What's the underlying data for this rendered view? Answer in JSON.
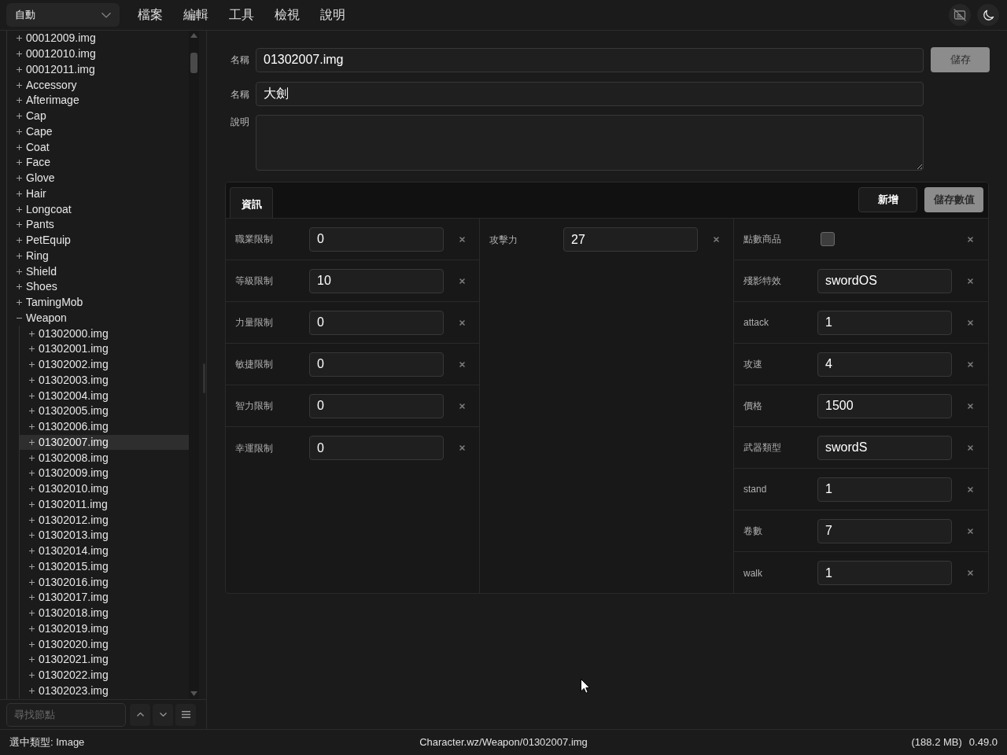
{
  "menu_bar": {
    "mode_select": {
      "value": "自動"
    },
    "menus": [
      "檔案",
      "編輯",
      "工具",
      "檢視",
      "說明"
    ]
  },
  "tree": {
    "items": [
      {
        "label": "00012009.img",
        "expanded": false,
        "selected": false
      },
      {
        "label": "00012010.img",
        "expanded": false,
        "selected": false
      },
      {
        "label": "00012011.img",
        "expanded": false,
        "selected": false
      },
      {
        "label": "Accessory",
        "expanded": false,
        "selected": false
      },
      {
        "label": "Afterimage",
        "expanded": false,
        "selected": false
      },
      {
        "label": "Cap",
        "expanded": false,
        "selected": false
      },
      {
        "label": "Cape",
        "expanded": false,
        "selected": false
      },
      {
        "label": "Coat",
        "expanded": false,
        "selected": false
      },
      {
        "label": "Face",
        "expanded": false,
        "selected": false
      },
      {
        "label": "Glove",
        "expanded": false,
        "selected": false
      },
      {
        "label": "Hair",
        "expanded": false,
        "selected": false
      },
      {
        "label": "Longcoat",
        "expanded": false,
        "selected": false
      },
      {
        "label": "Pants",
        "expanded": false,
        "selected": false
      },
      {
        "label": "PetEquip",
        "expanded": false,
        "selected": false
      },
      {
        "label": "Ring",
        "expanded": false,
        "selected": false
      },
      {
        "label": "Shield",
        "expanded": false,
        "selected": false
      },
      {
        "label": "Shoes",
        "expanded": false,
        "selected": false
      },
      {
        "label": "TamingMob",
        "expanded": false,
        "selected": false
      },
      {
        "label": "Weapon",
        "expanded": true,
        "selected": false,
        "children": [
          {
            "label": "01302000.img",
            "expanded": false,
            "selected": false
          },
          {
            "label": "01302001.img",
            "expanded": false,
            "selected": false
          },
          {
            "label": "01302002.img",
            "expanded": false,
            "selected": false
          },
          {
            "label": "01302003.img",
            "expanded": false,
            "selected": false
          },
          {
            "label": "01302004.img",
            "expanded": false,
            "selected": false
          },
          {
            "label": "01302005.img",
            "expanded": false,
            "selected": false
          },
          {
            "label": "01302006.img",
            "expanded": false,
            "selected": false
          },
          {
            "label": "01302007.img",
            "expanded": false,
            "selected": true
          },
          {
            "label": "01302008.img",
            "expanded": false,
            "selected": false
          },
          {
            "label": "01302009.img",
            "expanded": false,
            "selected": false
          },
          {
            "label": "01302010.img",
            "expanded": false,
            "selected": false
          },
          {
            "label": "01302011.img",
            "expanded": false,
            "selected": false
          },
          {
            "label": "01302012.img",
            "expanded": false,
            "selected": false
          },
          {
            "label": "01302013.img",
            "expanded": false,
            "selected": false
          },
          {
            "label": "01302014.img",
            "expanded": false,
            "selected": false
          },
          {
            "label": "01302015.img",
            "expanded": false,
            "selected": false
          },
          {
            "label": "01302016.img",
            "expanded": false,
            "selected": false
          },
          {
            "label": "01302017.img",
            "expanded": false,
            "selected": false
          },
          {
            "label": "01302018.img",
            "expanded": false,
            "selected": false
          },
          {
            "label": "01302019.img",
            "expanded": false,
            "selected": false
          },
          {
            "label": "01302020.img",
            "expanded": false,
            "selected": false
          },
          {
            "label": "01302021.img",
            "expanded": false,
            "selected": false
          },
          {
            "label": "01302022.img",
            "expanded": false,
            "selected": false
          },
          {
            "label": "01302023.img",
            "expanded": false,
            "selected": false
          }
        ]
      }
    ]
  },
  "tree_search": {
    "placeholder": "尋找節點"
  },
  "editor": {
    "fields": [
      {
        "kind": "input",
        "label": "名稱",
        "value": "01302007.img"
      },
      {
        "kind": "input",
        "label": "名稱",
        "value": "大劍"
      },
      {
        "kind": "textarea",
        "label": "說明"
      }
    ],
    "save_button": {
      "label": "儲存",
      "disabled": true
    },
    "properties": {
      "tabs": [
        {
          "label": "資訊",
          "selected": true
        }
      ],
      "actions": [
        {
          "label": "新增",
          "kind": "outline",
          "disabled": false
        },
        {
          "label": "儲存數值",
          "kind": "primary",
          "disabled": true
        }
      ],
      "columns": [
        {
          "rows": [
            {
              "kind": "text",
              "label": "職業限制",
              "value": "0"
            },
            {
              "kind": "text",
              "label": "等級限制",
              "value": "10"
            },
            {
              "kind": "text",
              "label": "力量限制",
              "value": "0"
            },
            {
              "kind": "text",
              "label": "敏捷限制",
              "value": "0"
            },
            {
              "kind": "text",
              "label": "智力限制",
              "value": "0"
            },
            {
              "kind": "text",
              "label": "幸運限制",
              "value": "0"
            }
          ]
        },
        {
          "rows": [
            {
              "kind": "text",
              "label": "攻擊力",
              "value": "27"
            }
          ]
        },
        {
          "rows": [
            {
              "kind": "checkbox",
              "label": "點數商品",
              "checked": false
            },
            {
              "kind": "text",
              "label": "殘影特效",
              "value": "swordOS"
            },
            {
              "kind": "text",
              "label": "attack",
              "value": "1"
            },
            {
              "kind": "text",
              "label": "攻速",
              "value": "4"
            },
            {
              "kind": "text",
              "label": "價格",
              "value": "1500"
            },
            {
              "kind": "text",
              "label": "武器類型",
              "value": "swordS"
            },
            {
              "kind": "text",
              "label": "stand",
              "value": "1"
            },
            {
              "kind": "text",
              "label": "卷數",
              "value": "7"
            },
            {
              "kind": "text",
              "label": "walk",
              "value": "1"
            }
          ]
        }
      ]
    }
  },
  "status_bar": {
    "selected_type": "選中類型: Image",
    "path": "Character.wz/Weapon/01302007.img",
    "memory": "(188.2 MB)",
    "version": "0.49.0"
  }
}
